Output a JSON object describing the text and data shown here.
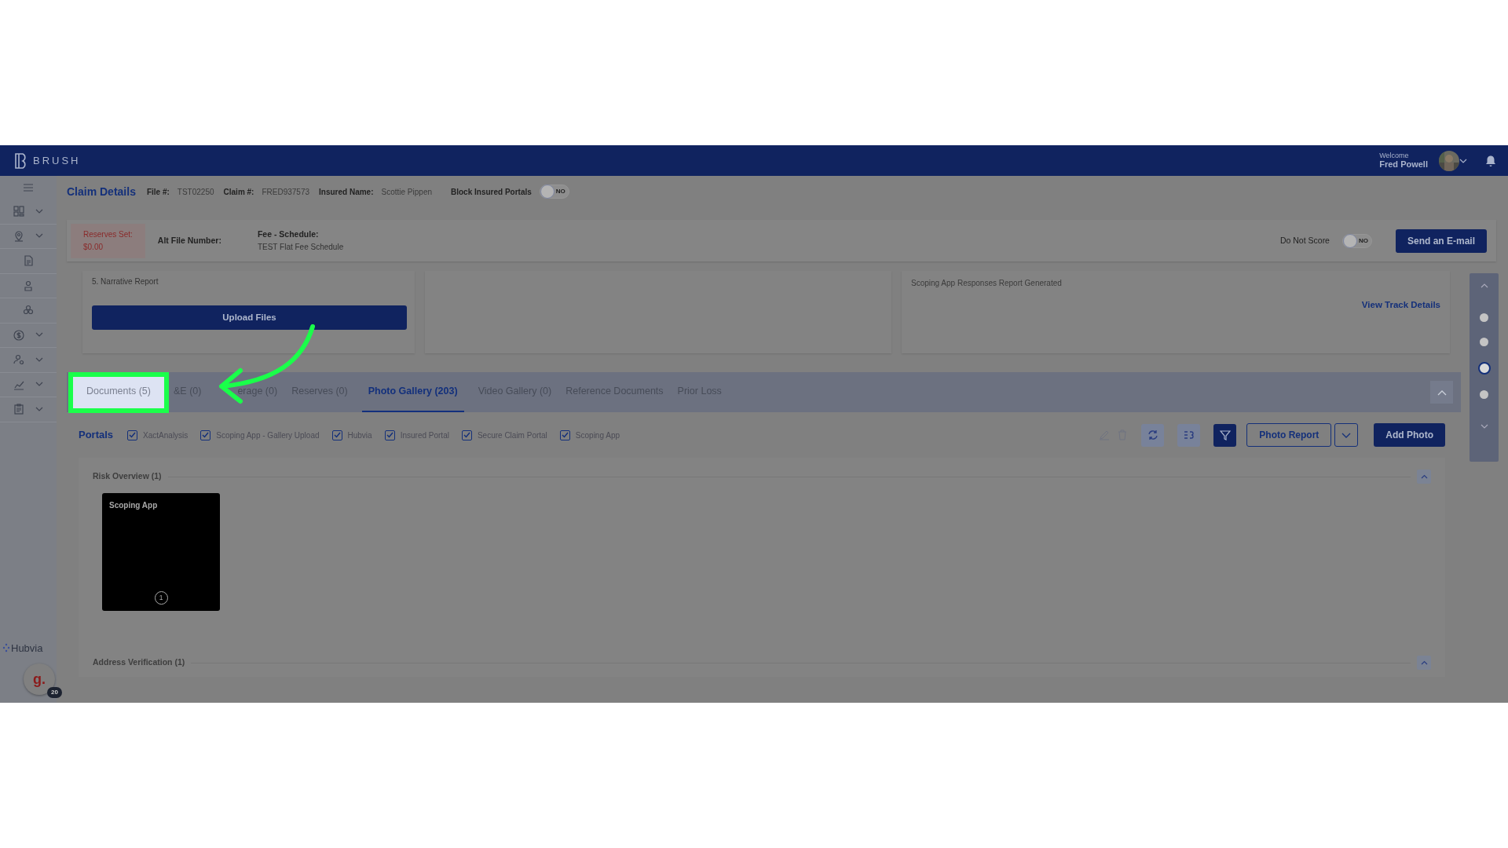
{
  "header": {
    "logo": "BRUSH",
    "welcome": "Welcome",
    "user": "Fred Powell"
  },
  "sidebar": {
    "items": [
      {
        "expandable": true
      },
      {
        "expandable": true
      },
      {
        "expandable": false
      },
      {
        "expandable": false
      },
      {
        "expandable": false
      },
      {
        "expandable": true
      },
      {
        "expandable": true
      },
      {
        "expandable": true
      },
      {
        "expandable": true
      }
    ],
    "hubvia": "Hubvia",
    "widget": {
      "letter": "g.",
      "badge": "20"
    }
  },
  "claim": {
    "title": "Claim Details",
    "fields": [
      {
        "label": "File #:",
        "value": "TST02250"
      },
      {
        "label": "Claim #:",
        "value": "FRED937573"
      },
      {
        "label": "Insured Name:",
        "value": "Scottie Pippen"
      }
    ],
    "block_portals": {
      "label": "Block Insured Portals",
      "on": false,
      "text": "NO"
    }
  },
  "info": {
    "reserves_label": "Reserves Set:",
    "reserves_value": "$0.00",
    "alt_file_label": "Alt File Number:",
    "fee_label": "Fee - Schedule:",
    "fee_value": "TEST Flat Fee Schedule",
    "do_not_score": {
      "label": "Do Not Score",
      "on": false,
      "text": "NO"
    },
    "email_button": "Send an E-mail"
  },
  "cards": {
    "narrative": "5. Narrative Report",
    "upload_button": "Upload Files",
    "track_text": "Scoping App Responses Report Generated",
    "track_link": "View Track Details"
  },
  "tabs": [
    {
      "label": "Documents (5)",
      "selected": false,
      "highlighted": true
    },
    {
      "label": "&E (0)",
      "selected": false,
      "highlighted": false
    },
    {
      "label": "erage (0)",
      "selected": false,
      "highlighted": false
    },
    {
      "label": "Reserves (0)",
      "selected": false,
      "highlighted": false
    },
    {
      "label": "Photo Gallery (203)",
      "selected": true,
      "highlighted": false
    },
    {
      "label": "Video Gallery (0)",
      "selected": false,
      "highlighted": false
    },
    {
      "label": "Reference Documents",
      "selected": false,
      "highlighted": false
    },
    {
      "label": "Prior Loss",
      "selected": false,
      "highlighted": false
    }
  ],
  "portals": {
    "title": "Portals",
    "items": [
      {
        "label": "XactAnalysis",
        "checked": true
      },
      {
        "label": "Scoping App - Gallery Upload",
        "checked": true
      },
      {
        "label": "Hubvia",
        "checked": true
      },
      {
        "label": "Insured Portal",
        "checked": true
      },
      {
        "label": "Secure Claim Portal",
        "checked": true
      },
      {
        "label": "Scoping App",
        "checked": true
      }
    ]
  },
  "toolbar": {
    "photo_report": "Photo Report",
    "add_photo": "Add Photo"
  },
  "sections": [
    {
      "title": "Risk Overview (1)",
      "albums": [
        {
          "title": "Scoping App",
          "count": "1"
        }
      ]
    },
    {
      "title": "Address Verification (1)"
    }
  ],
  "side_nav": {
    "dots": [
      {
        "selected": false
      },
      {
        "selected": false
      },
      {
        "selected": true
      },
      {
        "selected": false
      }
    ]
  }
}
